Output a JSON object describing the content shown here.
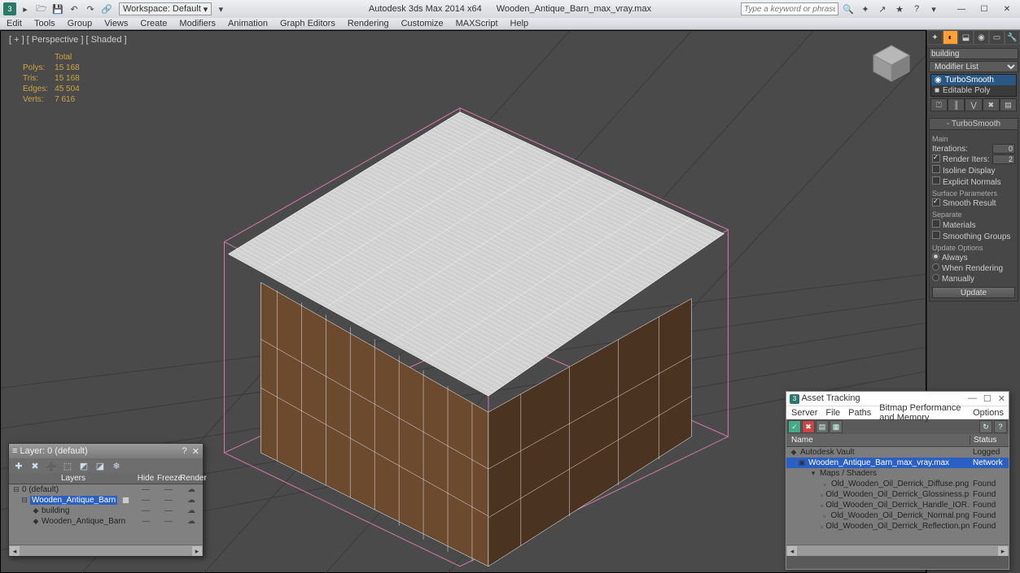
{
  "title": {
    "app": "Autodesk 3ds Max  2014 x64",
    "file": "Wooden_Antique_Barn_max_vray.max"
  },
  "workspace": {
    "label": "Workspace: Default"
  },
  "search": {
    "placeholder": "Type a keyword or phrase"
  },
  "menu": [
    "Edit",
    "Tools",
    "Group",
    "Views",
    "Create",
    "Modifiers",
    "Animation",
    "Graph Editors",
    "Rendering",
    "Customize",
    "MAXScript",
    "Help"
  ],
  "viewport": {
    "label": "[ + ] [ Perspective ] [ Shaded ]"
  },
  "stats": {
    "headTotal": "Total",
    "rows": [
      {
        "k": "Polys:",
        "v": "15 168"
      },
      {
        "k": "Tris:",
        "v": "15 168"
      },
      {
        "k": "Edges:",
        "v": "45 504"
      },
      {
        "k": "Verts:",
        "v": "7 616"
      }
    ]
  },
  "cmd": {
    "name": "building",
    "modifierListLabel": "Modifier List",
    "stack": [
      "TurboSmooth",
      "Editable Poly"
    ],
    "rolloutTitle": "TurboSmooth",
    "main": "Main",
    "iterLabel": "Iterations:",
    "iterVal": "0",
    "renderIterLabel": "Render Iters:",
    "renderIterVal": "2",
    "isoline": "Isoline Display",
    "explicit": "Explicit Normals",
    "surface": "Surface Parameters",
    "smoothResult": "Smooth Result",
    "separate": "Separate",
    "materials": "Materials",
    "smgroups": "Smoothing Groups",
    "updateOpt": "Update Options",
    "always": "Always",
    "whenRender": "When Rendering",
    "manually": "Manually",
    "update": "Update"
  },
  "layer": {
    "title": "Layer: 0 (default)",
    "cols": [
      "Layers",
      "Hide",
      "Freeze",
      "Render"
    ],
    "rows": [
      {
        "name": "0 (default)",
        "indent": 0,
        "sel": false,
        "icon": "⊟"
      },
      {
        "name": "Wooden_Antique_Barn",
        "indent": 1,
        "sel": true,
        "icon": "⊟"
      },
      {
        "name": "building",
        "indent": 2,
        "sel": false,
        "icon": "◆"
      },
      {
        "name": "Wooden_Antique_Barn",
        "indent": 2,
        "sel": false,
        "icon": "◆"
      }
    ]
  },
  "asset": {
    "title": "Asset Tracking",
    "menu": [
      "Server",
      "File",
      "Paths",
      "Bitmap Performance and Memory",
      "Options"
    ],
    "cols": [
      "Name",
      "Status"
    ],
    "rows": [
      {
        "name": "Autodesk Vault",
        "status": "Logged",
        "indent": 0,
        "icon": "◆"
      },
      {
        "name": "Wooden_Antique_Barn_max_vray.max",
        "status": "Network",
        "indent": 1,
        "icon": "▣",
        "sel": true
      },
      {
        "name": "Maps / Shaders",
        "status": "",
        "indent": 2,
        "icon": "▾"
      },
      {
        "name": "Old_Wooden_Oil_Derrick_Diffuse.png",
        "status": "Found",
        "indent": 3,
        "icon": "▫"
      },
      {
        "name": "Old_Wooden_Oil_Derrick_Glossiness.png",
        "status": "Found",
        "indent": 3,
        "icon": "▫"
      },
      {
        "name": "Old_Wooden_Oil_Derrick_Handle_IOR.png",
        "status": "Found",
        "indent": 3,
        "icon": "▫"
      },
      {
        "name": "Old_Wooden_Oil_Derrick_Normal.png",
        "status": "Found",
        "indent": 3,
        "icon": "▫"
      },
      {
        "name": "Old_Wooden_Oil_Derrick_Reflection.png",
        "status": "Found",
        "indent": 3,
        "icon": "▫"
      }
    ]
  }
}
